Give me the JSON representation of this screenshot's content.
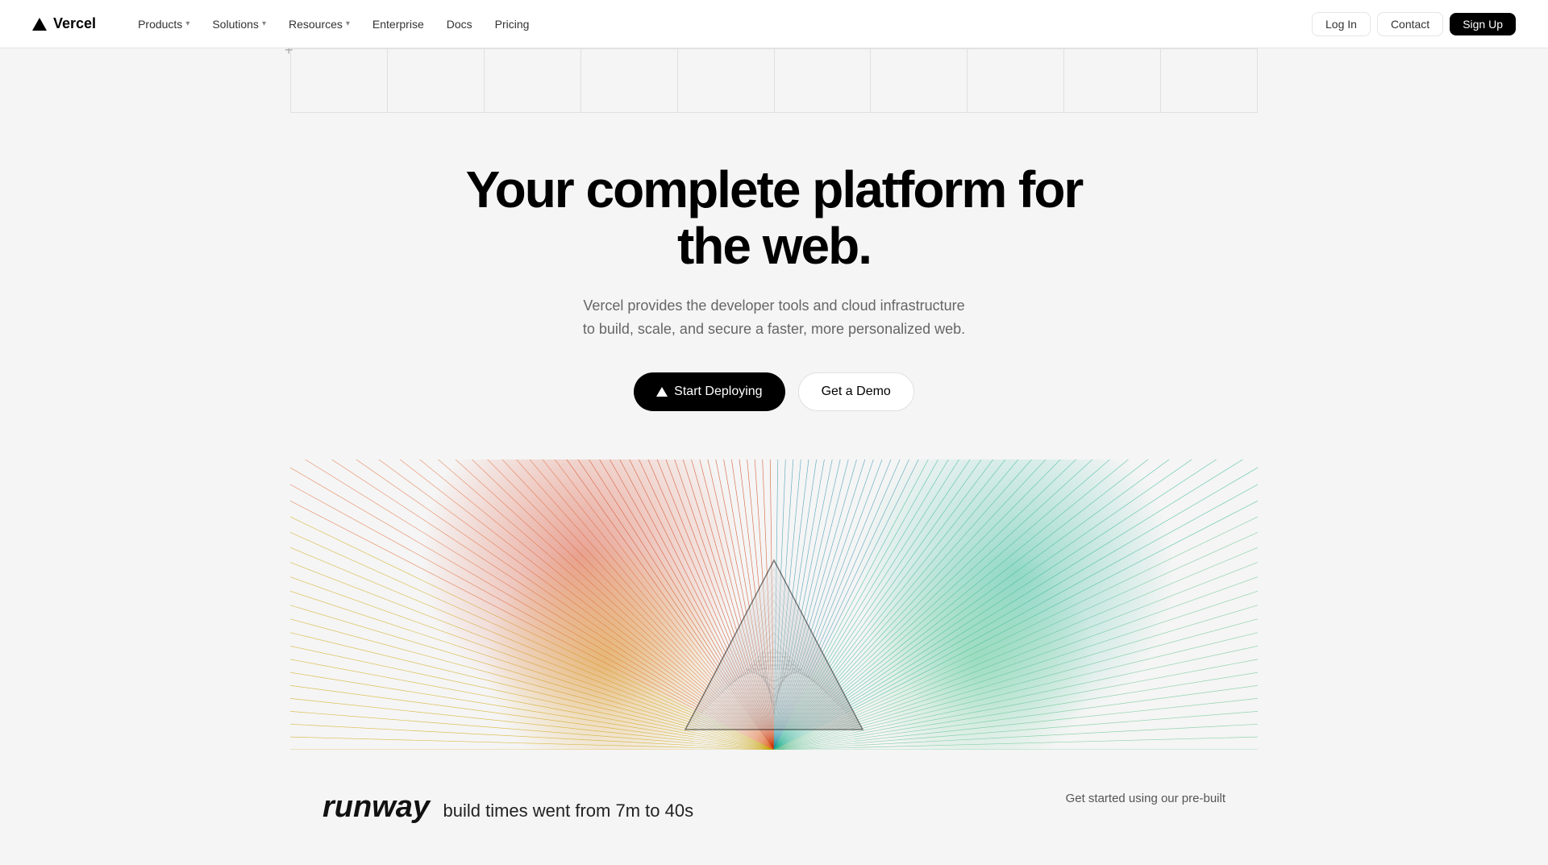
{
  "nav": {
    "logo_text": "Vercel",
    "links": [
      {
        "label": "Products",
        "has_dropdown": true
      },
      {
        "label": "Solutions",
        "has_dropdown": true
      },
      {
        "label": "Resources",
        "has_dropdown": true
      },
      {
        "label": "Enterprise",
        "has_dropdown": false
      },
      {
        "label": "Docs",
        "has_dropdown": false
      },
      {
        "label": "Pricing",
        "has_dropdown": false
      }
    ],
    "login_label": "Log In",
    "contact_label": "Contact",
    "signup_label": "Sign Up"
  },
  "hero": {
    "title": "Your complete platform for the web.",
    "subtitle_line1": "Vercel provides the developer tools and cloud infrastructure",
    "subtitle_line2": "to build, scale, and secure a faster, more personalized web.",
    "cta_deploy": "Start Deploying",
    "cta_demo": "Get a Demo"
  },
  "lower": {
    "runway_text": "runway",
    "build_times": "build times went from 7m to 40s",
    "right_text": "Get started using our pre-built"
  },
  "colors": {
    "accent_black": "#000000",
    "accent_white": "#ffffff",
    "bg": "#f5f5f5",
    "text_muted": "#666666"
  }
}
